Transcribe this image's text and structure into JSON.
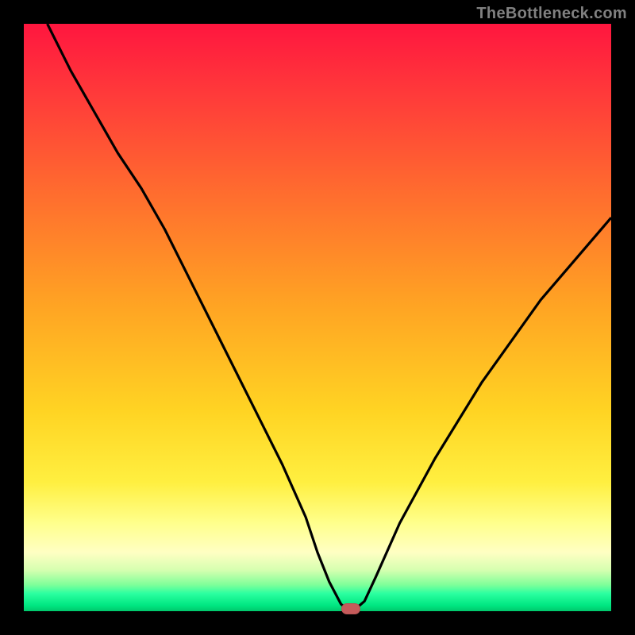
{
  "watermark": "TheBottleneck.com",
  "colors": {
    "background": "#000000",
    "gradient_top": "#ff163f",
    "gradient_mid": "#ffd423",
    "gradient_bottom": "#00c86b",
    "curve": "#000000",
    "marker": "#c55a5a"
  },
  "chart_data": {
    "type": "line",
    "title": "",
    "xlabel": "",
    "ylabel": "",
    "xlim": [
      0,
      100
    ],
    "ylim": [
      0,
      100
    ],
    "legend": false,
    "grid": false,
    "series": [
      {
        "name": "bottleneck-curve",
        "x": [
          4,
          8,
          12,
          16,
          20,
          24,
          28,
          32,
          36,
          40,
          44,
          48,
          50,
          52,
          54,
          55,
          56.5,
          58,
          60,
          64,
          70,
          78,
          88,
          100
        ],
        "values": [
          100,
          92,
          85,
          78,
          72,
          65,
          57,
          49,
          41,
          33,
          25,
          16,
          10,
          5,
          1.2,
          0.4,
          0.4,
          1.7,
          6,
          15,
          26,
          39,
          53,
          67
        ]
      }
    ],
    "marker": {
      "x": 55.7,
      "y": 0.4,
      "label": "optimal-point"
    },
    "annotations": [
      {
        "text": "TheBottleneck.com",
        "role": "watermark",
        "position": "top-right"
      }
    ]
  }
}
